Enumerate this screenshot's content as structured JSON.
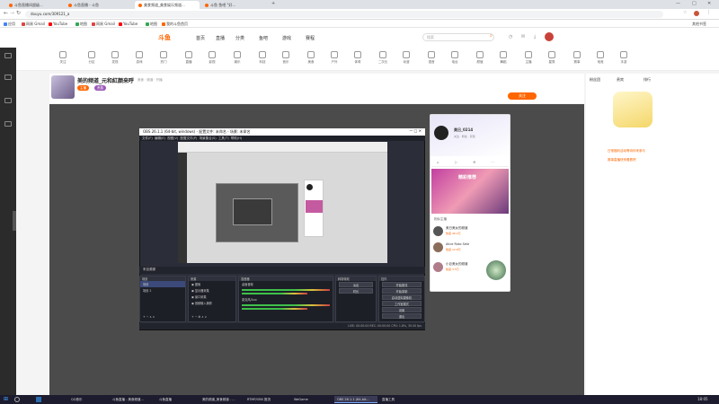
{
  "browser": {
    "tabs": [
      {
        "label": "斗鱼直播间超级..."
      },
      {
        "label": "斗鱼直播 - 斗鱼"
      },
      {
        "label": "美食频道_美食娱乐频道..."
      },
      {
        "label": "斗鱼 鱼吧 \"好..."
      }
    ],
    "url": "douyu.com/309121_a",
    "bookmarks": [
      "应用",
      "网易 Gmail",
      "YouTube",
      "地图",
      "网易 Gmail",
      "YouTube",
      "地图",
      "我的斗鱼首页"
    ],
    "other_bookmarks": "其他书签"
  },
  "header": {
    "logo": "斗鱼",
    "nav": [
      "首页",
      "直播",
      "分类",
      "鱼吧",
      "游戏",
      "赛程"
    ],
    "search_placeholder": "搜索"
  },
  "categories": [
    "关注",
    "分区",
    "发现",
    "游戏",
    "热门",
    "直播",
    "影视",
    "娱乐",
    "科技",
    "音乐",
    "美食",
    "户外",
    "体育",
    "二次元",
    "动漫",
    "语音",
    "电台",
    "颜值",
    "舞蹈",
    "主播",
    "星秀",
    "赛事",
    "电竞",
    "手游"
  ],
  "stream": {
    "level": "12",
    "title": "美的频道_元和紅颜来呼",
    "meta": "美食 · 频道 · 开播",
    "badges": [
      "主播",
      "贵族"
    ],
    "follow_label": "关注"
  },
  "obs": {
    "title": "OBS 26.1.1 (64-bit, windows) - 配置文件: 未命名 - 场景: 未命名",
    "menu": [
      "文件(F)",
      "编辑(E)",
      "视图(V)",
      "配置文件(P)",
      "场景集合(S)",
      "工具(T)",
      "帮助(H)"
    ],
    "source_bar": "来自源源",
    "docks": {
      "scenes": {
        "title": "场景",
        "items": [
          "场景",
          "场景 2"
        ]
      },
      "sources": {
        "title": "来源",
        "items": [
          "图像",
          "显示器采集",
          "窗口采集",
          "音频输入捕获"
        ]
      },
      "mixer": {
        "title": "混音器",
        "items": [
          "桌面音频",
          "麦克风/Aux"
        ]
      },
      "transitions": {
        "title": "转场特效",
        "items": [
          "淡出",
          "时长"
        ]
      },
      "controls": {
        "title": "控件",
        "buttons": [
          "开始推流",
          "开始录制",
          "启动虚拟摄像机",
          "工作室模式",
          "设置",
          "退出"
        ]
      }
    },
    "status": "LIVE: 00:00:00   REC: 00:00:00   CPU: 1.8%, 30.00 fps"
  },
  "phone": {
    "name": "美日_0214",
    "sub": "关注 · 粉丝 · 获赞",
    "banner": "精彩推荐",
    "section": "相似主播",
    "items": [
      {
        "name": "美日美女的频道",
        "sub": "热度 46.2万"
      },
      {
        "name": "Alice Ruto Sele",
        "sub": "热度 12.8万"
      },
      {
        "name": "小巨美女的频道",
        "sub": "热度 3.5万"
      }
    ]
  },
  "right_panel": {
    "tabs": [
      "粉丝团",
      "贵宾",
      "排行"
    ],
    "notices": [
      "日常福利活动等待你来参与",
      "赛事直播快来看看吧"
    ]
  },
  "taskbar": {
    "items": [
      "QQ音乐",
      "斗鱼直播 - 美食频道...",
      "斗鱼直播",
      "美的频道_美食频道 - ...",
      "RTMP/OBS 推流",
      "WeGame",
      "OBS 26.1.1 (64-bit...",
      "直播工具"
    ],
    "clock": "18:05"
  }
}
